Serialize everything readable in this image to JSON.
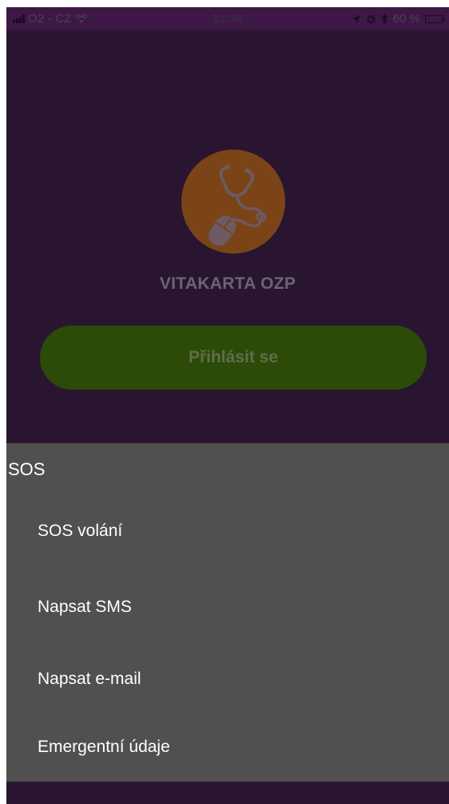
{
  "status_bar": {
    "carrier": "O2 - CZ",
    "time": "13:38",
    "battery_percent": "60 %",
    "battery_level": 0.6,
    "icons": [
      "signal-icon",
      "wifi-icon",
      "location-arrow-icon",
      "alarm-icon",
      "bluetooth-icon",
      "battery-icon"
    ]
  },
  "login": {
    "app_title": "VITAKARTA OZP",
    "login_button_label": "Přihlásit se",
    "logo_icon": "stethoscope-mouse-icon"
  },
  "sos_menu": {
    "title": "SOS",
    "items": [
      {
        "label": "SOS volání"
      },
      {
        "label": "Napsat SMS"
      },
      {
        "label": "Napsat e-mail"
      },
      {
        "label": "Emergentní údaje"
      }
    ]
  },
  "colors": {
    "background_dimmed": "#2a1530",
    "status_bar_dimmed": "#3d1846",
    "logo_circle_dimmed": "#7a4416",
    "login_button_dimmed": "#2c4b09",
    "sheet_background": "#505050",
    "sheet_text": "#ffffff"
  }
}
